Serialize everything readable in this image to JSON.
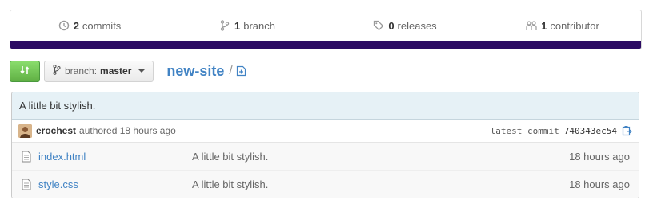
{
  "stats": {
    "commits": {
      "count": "2",
      "label": "commits",
      "icon": "history-icon"
    },
    "branches": {
      "count": "1",
      "label": "branch",
      "icon": "branch-icon"
    },
    "releases": {
      "count": "0",
      "label": "releases",
      "icon": "tag-icon"
    },
    "contributors": {
      "count": "1",
      "label": "contributor",
      "icon": "organization-icon"
    },
    "language_bar_color": "#2b0a63"
  },
  "toolbar": {
    "compare_icon": "compare-icon",
    "branch_label": "branch:",
    "branch_value": "master",
    "repo_name": "new-site",
    "path_separator": "/",
    "new_file_icon": "new-file-icon"
  },
  "commit": {
    "message": "A little bit stylish.",
    "author": "erochest",
    "authored": "authored 18 hours ago",
    "latest_label": "latest commit",
    "sha": "740343ec54",
    "copy_icon": "clipboard-icon"
  },
  "files": [
    {
      "name": "index.html",
      "message": "A little bit stylish.",
      "age": "18 hours ago",
      "icon": "file-icon"
    },
    {
      "name": "style.css",
      "message": "A little bit stylish.",
      "age": "18 hours ago",
      "icon": "file-icon"
    }
  ],
  "colors": {
    "link": "#4183c4",
    "compare_button": "#60b044",
    "commit_header_bg": "#e6f1f6"
  }
}
